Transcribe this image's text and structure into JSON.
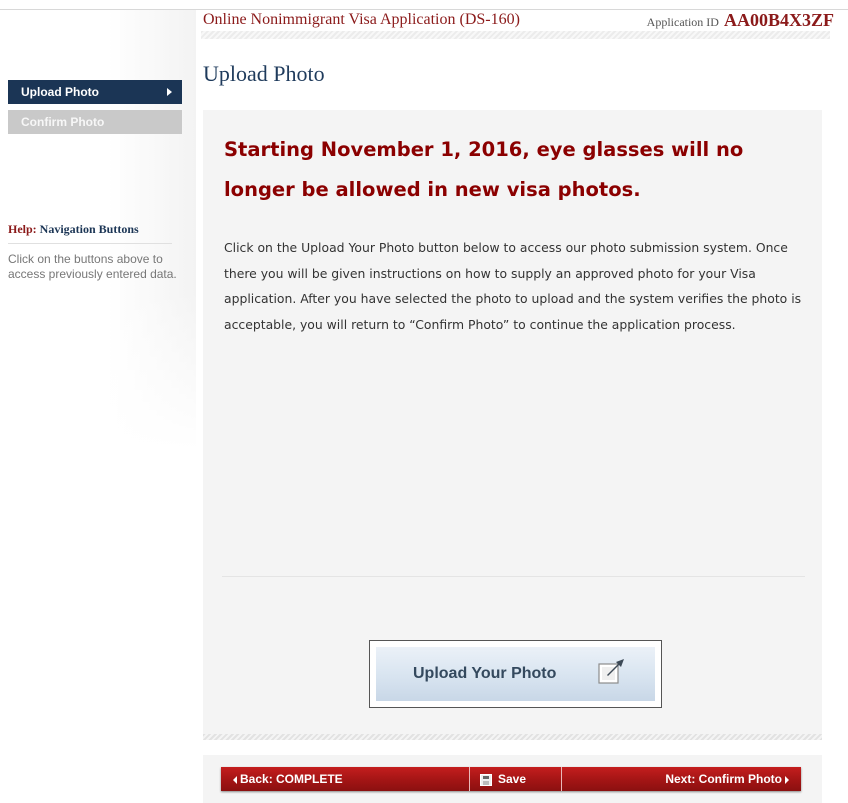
{
  "header": {
    "title": "Online Nonimmigrant Visa Application (DS-160)",
    "app_id_label": "Application ID",
    "app_id_value": "AA00B4X3ZF"
  },
  "page": {
    "title": "Upload Photo"
  },
  "sidebar": {
    "items": [
      {
        "label": "Upload Photo",
        "active": true
      },
      {
        "label": "Confirm Photo",
        "active": false
      }
    ]
  },
  "help": {
    "prefix": "Help:",
    "title": "Navigation Buttons",
    "text": "Click on the buttons above to access previously entered data."
  },
  "main": {
    "notice": "Starting November 1, 2016, eye glasses will no longer be allowed in new visa photos.",
    "instructions": "Click on the Upload Your Photo button below to access our photo submission system. Once there you will be given instructions on how to supply an approved photo for your Visa application. After you have selected the photo to upload and the system verifies the photo is acceptable, you will return to “Confirm Photo” to continue the application process.",
    "upload_button": {
      "label": "Upload Your Photo",
      "icon": "upload-icon"
    }
  },
  "footer": {
    "back_label": "Back: COMPLETE",
    "save_label": "Save",
    "next_label": "Next: Confirm Photo"
  },
  "colors": {
    "brand_red": "#8b1a1a",
    "navy": "#1b3555",
    "button_bar": "#a01414"
  }
}
